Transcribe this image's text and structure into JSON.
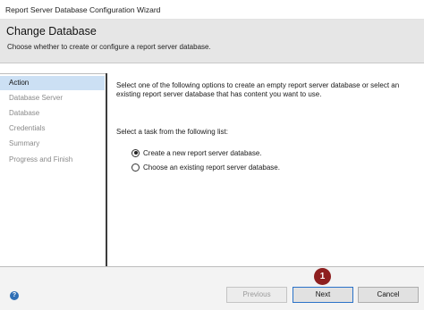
{
  "window": {
    "title": "Report Server Database Configuration Wizard"
  },
  "banner": {
    "title": "Change Database",
    "subtitle": "Choose whether to create or configure a report server database."
  },
  "nav": {
    "items": [
      {
        "label": "Action",
        "active": true
      },
      {
        "label": "Database Server",
        "active": false
      },
      {
        "label": "Database",
        "active": false
      },
      {
        "label": "Credentials",
        "active": false
      },
      {
        "label": "Summary",
        "active": false
      },
      {
        "label": "Progress and Finish",
        "active": false
      }
    ]
  },
  "main": {
    "description": "Select one of the following options to create an empty report server database or select an existing report server database that has content you want to use.",
    "task_label": "Select a task from the following list:",
    "options": [
      {
        "label": "Create a new report server database.",
        "selected": true
      },
      {
        "label": "Choose an existing report server database.",
        "selected": false
      }
    ]
  },
  "footer": {
    "help_icon": "help-icon",
    "help_glyph": "?",
    "previous_label": "Previous",
    "next_label": "Next",
    "cancel_label": "Cancel",
    "step_marker": "1"
  },
  "colors": {
    "accent": "#2a72c8",
    "active_nav": "#cce0f4",
    "marker": "#8e1f1f"
  }
}
